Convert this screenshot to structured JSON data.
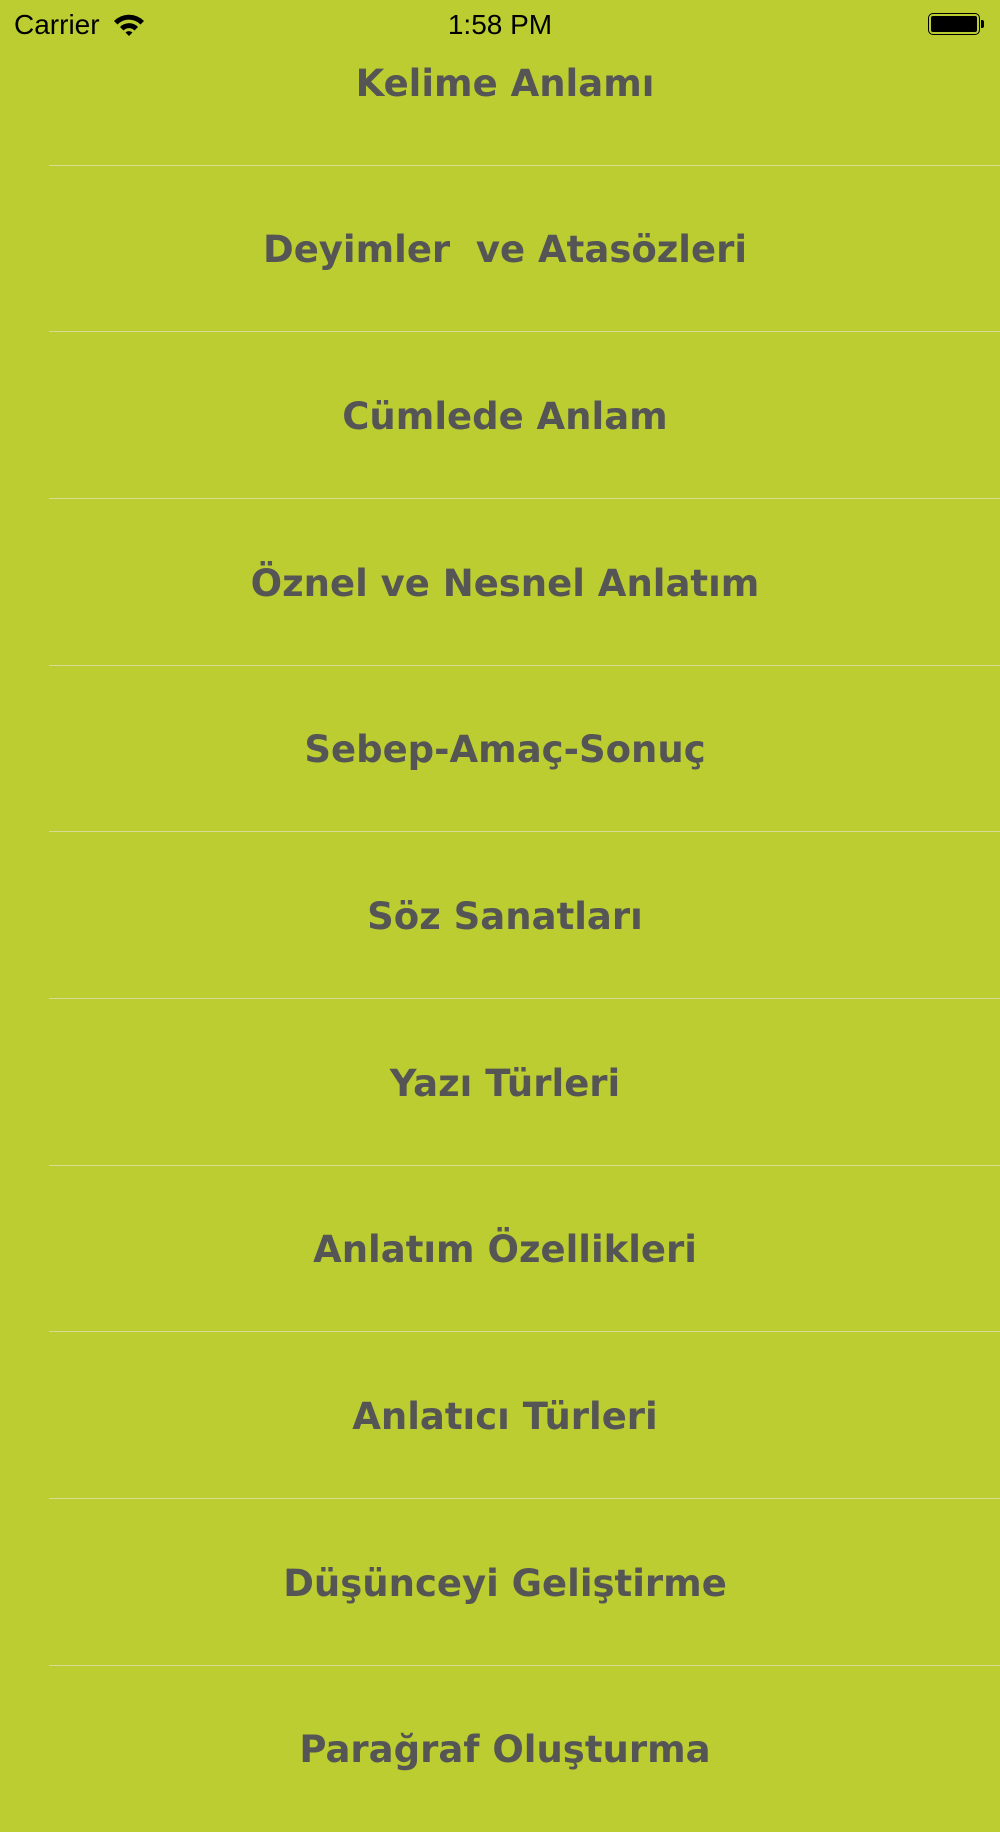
{
  "status_bar": {
    "carrier": "Carrier",
    "time": "1:58 PM",
    "battery_level": 1.0
  },
  "colors": {
    "background": "#bccd31",
    "text": "#555555",
    "divider": "#d6dd92"
  },
  "menu": {
    "items": [
      {
        "label": "Kelime Anlamı"
      },
      {
        "label": "Deyimler  ve Atasözleri"
      },
      {
        "label": "Cümlede Anlam"
      },
      {
        "label": "Öznel ve Nesnel Anlatım"
      },
      {
        "label": "Sebep-Amaç-Sonuç"
      },
      {
        "label": "Söz Sanatları"
      },
      {
        "label": "Yazı Türleri"
      },
      {
        "label": "Anlatım Özellikleri"
      },
      {
        "label": "Anlatıcı Türleri"
      },
      {
        "label": "Düşünceyi Geliştirme"
      },
      {
        "label": "Parağraf Oluşturma"
      }
    ]
  }
}
